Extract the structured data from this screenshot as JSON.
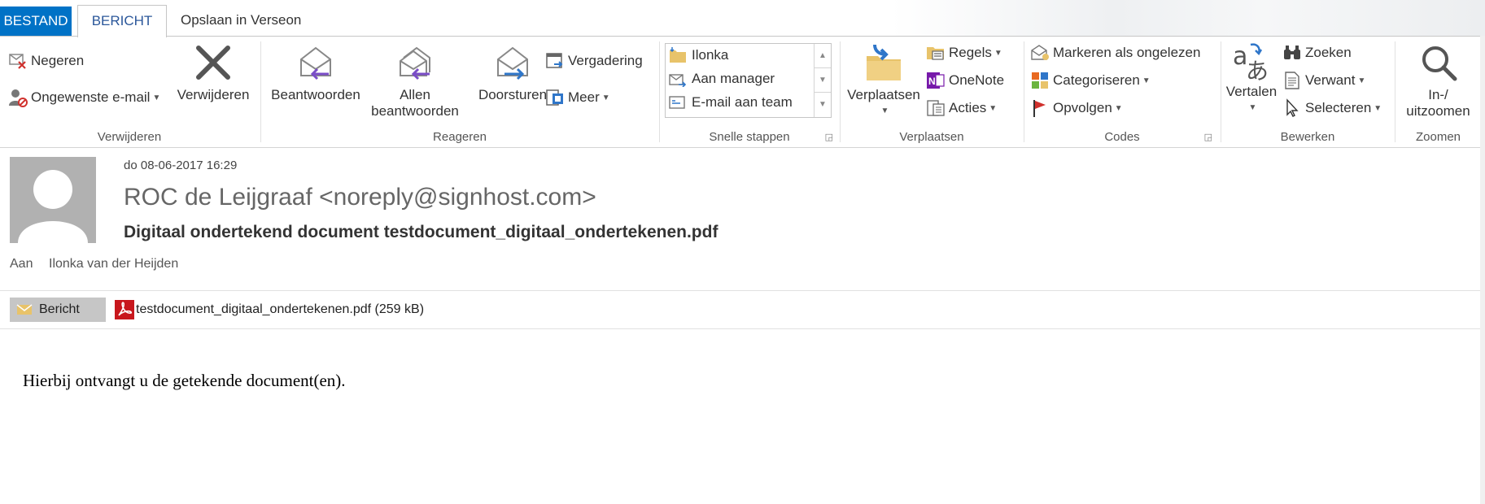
{
  "tabs": {
    "file": "BESTAND",
    "message": "BERICHT",
    "verseon": "Opslaan in Verseon"
  },
  "ribbon": {
    "delete_group": {
      "label": "Verwijderen",
      "ignore": "Negeren",
      "junk": "Ongewenste e-mail",
      "delete": "Verwijderen"
    },
    "respond_group": {
      "label": "Reageren",
      "reply": "Beantwoorden",
      "reply_all_line1": "Allen",
      "reply_all_line2": "beantwoorden",
      "forward": "Doorsturen",
      "meeting": "Vergadering",
      "more": "Meer"
    },
    "quick_steps_group": {
      "label": "Snelle stappen",
      "items": [
        "Ilonka",
        "Aan manager",
        "E-mail aan team"
      ]
    },
    "move_group": {
      "label": "Verplaatsen",
      "move": "Verplaatsen",
      "rules": "Regels",
      "onenote": "OneNote",
      "actions": "Acties"
    },
    "tags_group": {
      "label": "Codes",
      "mark_unread": "Markeren als ongelezen",
      "categorize": "Categoriseren",
      "follow_up": "Opvolgen"
    },
    "editing_group": {
      "label": "Bewerken",
      "translate": "Vertalen",
      "find": "Zoeken",
      "related": "Verwant",
      "select": "Selecteren"
    },
    "zoom_group": {
      "label": "Zoomen",
      "zoom_line1": "In-/",
      "zoom_line2": "uitzoomen"
    }
  },
  "message": {
    "date": "do 08-06-2017 16:29",
    "from": "ROC de Leijgraaf <noreply@signhost.com>",
    "subject": "Digitaal ondertekend document testdocument_digitaal_ondertekenen.pdf",
    "to_label": "Aan",
    "to": "Ilonka van der Heijden",
    "attachments": {
      "message_tab": "Bericht",
      "file": "testdocument_digitaal_ondertekenen.pdf (259 kB)"
    },
    "body": "Hierbij ontvangt u de getekende document(en)."
  },
  "colors": {
    "accent": "#0072c6",
    "tab_text": "#2b579a",
    "reply_purple": "#7a4dc7",
    "forward_blue": "#2f76c9",
    "folder_yellow": "#e8c36a",
    "pdf_red": "#c8171d"
  }
}
